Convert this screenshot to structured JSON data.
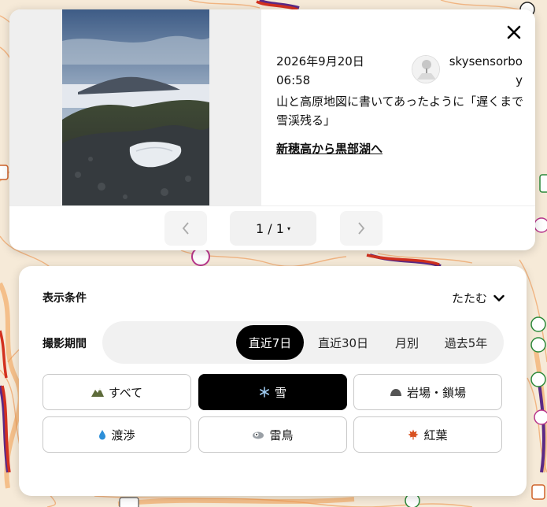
{
  "photo_popup": {
    "close_label": "✕",
    "date": "2026年9月20日",
    "time": "06:58",
    "username": "skysensorboy",
    "text": "山と高原地図に書いてあったように「遅くまで雪渓残る」",
    "route_link": "新穂高から黒部湖へ",
    "pager": {
      "current": "1 / 1",
      "caret": "▾"
    }
  },
  "filter": {
    "title": "表示条件",
    "collapse_label": "たたむ",
    "period_label": "撮影期間",
    "period_options": [
      "直近7日",
      "直近30日",
      "月別",
      "過去5年"
    ],
    "period_selected": "直近7日",
    "categories": [
      {
        "label": "すべて",
        "icon": "mountain-icon"
      },
      {
        "label": "雪",
        "icon": "snowflake-icon"
      },
      {
        "label": "岩場・鎖場",
        "icon": "rock-icon"
      },
      {
        "label": "渡渉",
        "icon": "water-drop-icon"
      },
      {
        "label": "雷鳥",
        "icon": "ptarmigan-icon"
      },
      {
        "label": "紅葉",
        "icon": "maple-leaf-icon"
      }
    ],
    "category_selected": "雪"
  },
  "colors": {
    "map_background": "#f6ead8",
    "contour": "#f0a261",
    "route_red": "#d3311f",
    "route_purple": "#5b2a86",
    "active_fill": "#000000"
  }
}
